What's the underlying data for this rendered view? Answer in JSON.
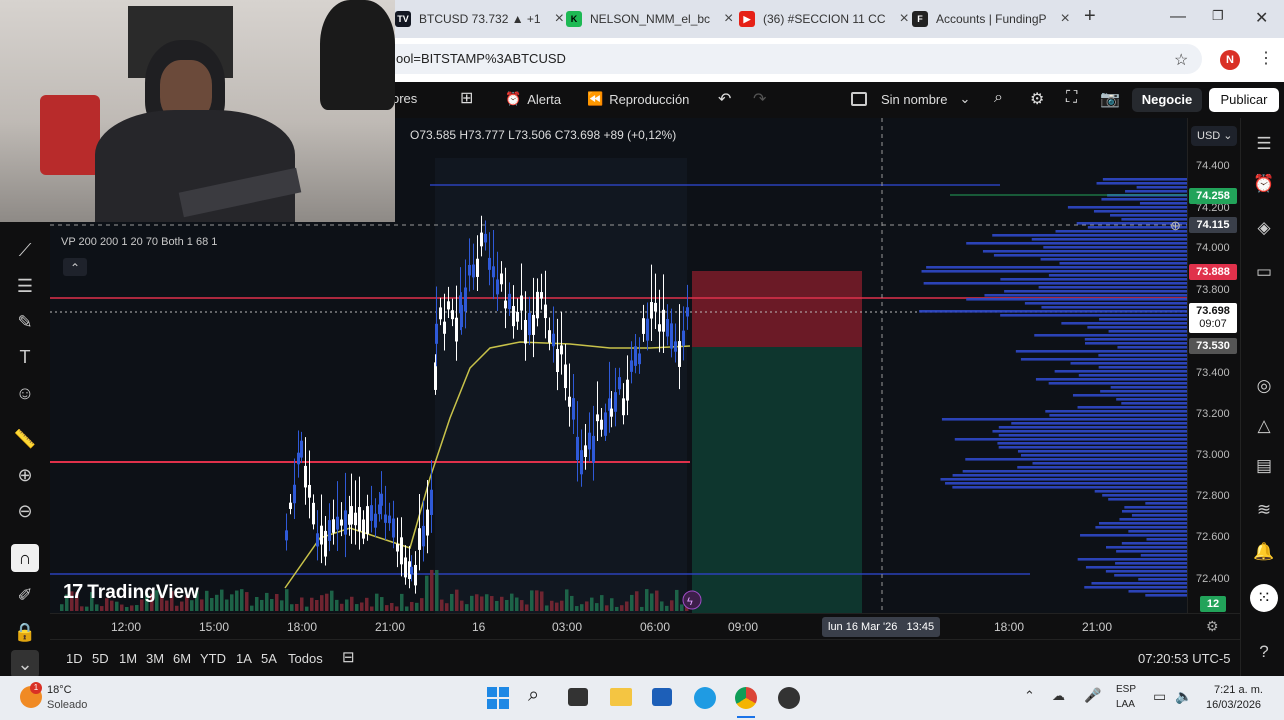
{
  "browser": {
    "tabs": [
      {
        "label": "BTCUSD 73.732 ▲ +1",
        "favicon": "tradingview-icon"
      },
      {
        "label": "NELSON_NMM_el_bc",
        "favicon": "kick-icon"
      },
      {
        "label": "(36) #SECCION 11 CC",
        "favicon": "youtube-icon"
      },
      {
        "label": "Accounts | FundingP",
        "favicon": "funding-icon"
      }
    ],
    "new_tab": "+",
    "url": "ool=BITSTAMP%3ABTCUSD",
    "profile_initial": "N"
  },
  "toolbar": {
    "indicators": "ores",
    "alert": "Alerta",
    "replay": "Reproducción",
    "layout_name": "Sin nombre",
    "trade_button": "Negocie",
    "publish_button": "Publicar"
  },
  "legend": {
    "ohlc": "O73.585 H73.777 L73.506 C73.698 +89 (+0,12%)",
    "indicator_line": "VP 200 200 1 20 70 Both 1 68 1",
    "collapse": "⌃"
  },
  "currency": "USD",
  "price_axis": {
    "ticks": [
      "74.400",
      "74.200",
      "74.000",
      "73.800",
      "73.400",
      "73.200",
      "73.000",
      "72.800",
      "72.600",
      "72.400"
    ],
    "tags": {
      "green": "74.258",
      "crosshair": "74.115",
      "red": "73.888",
      "last_price": "73.698",
      "countdown": "09:07",
      "bottom": "73.530",
      "volume": "12"
    }
  },
  "time_axis": {
    "ticks": [
      "12:00",
      "15:00",
      "18:00",
      "21:00",
      "16",
      "03:00",
      "06:00",
      "09:00",
      "18:00",
      "21:00"
    ],
    "crosshair_label": "lun 16 Mar '26   13:45"
  },
  "ranges": [
    "1D",
    "5D",
    "1M",
    "3M",
    "6M",
    "YTD",
    "1A",
    "5A",
    "Todos"
  ],
  "clock": "07:20:53 UTC-5",
  "watermark": "TradingView",
  "taskbar": {
    "weather_temp": "18°C",
    "weather_desc": "Soleado",
    "weather_badge": "1",
    "lang_top": "ESP",
    "lang_bottom": "LAA",
    "time": "7:21 a. m.",
    "date": "16/03/2026"
  },
  "colors": {
    "chart_bg": "#0d1117",
    "up_candle": "#ffffff",
    "down_candle": "#2f5ad8",
    "red_line": "#e0314b",
    "green_tag": "#22a35a",
    "volume_profile": "#2f49c9"
  }
}
